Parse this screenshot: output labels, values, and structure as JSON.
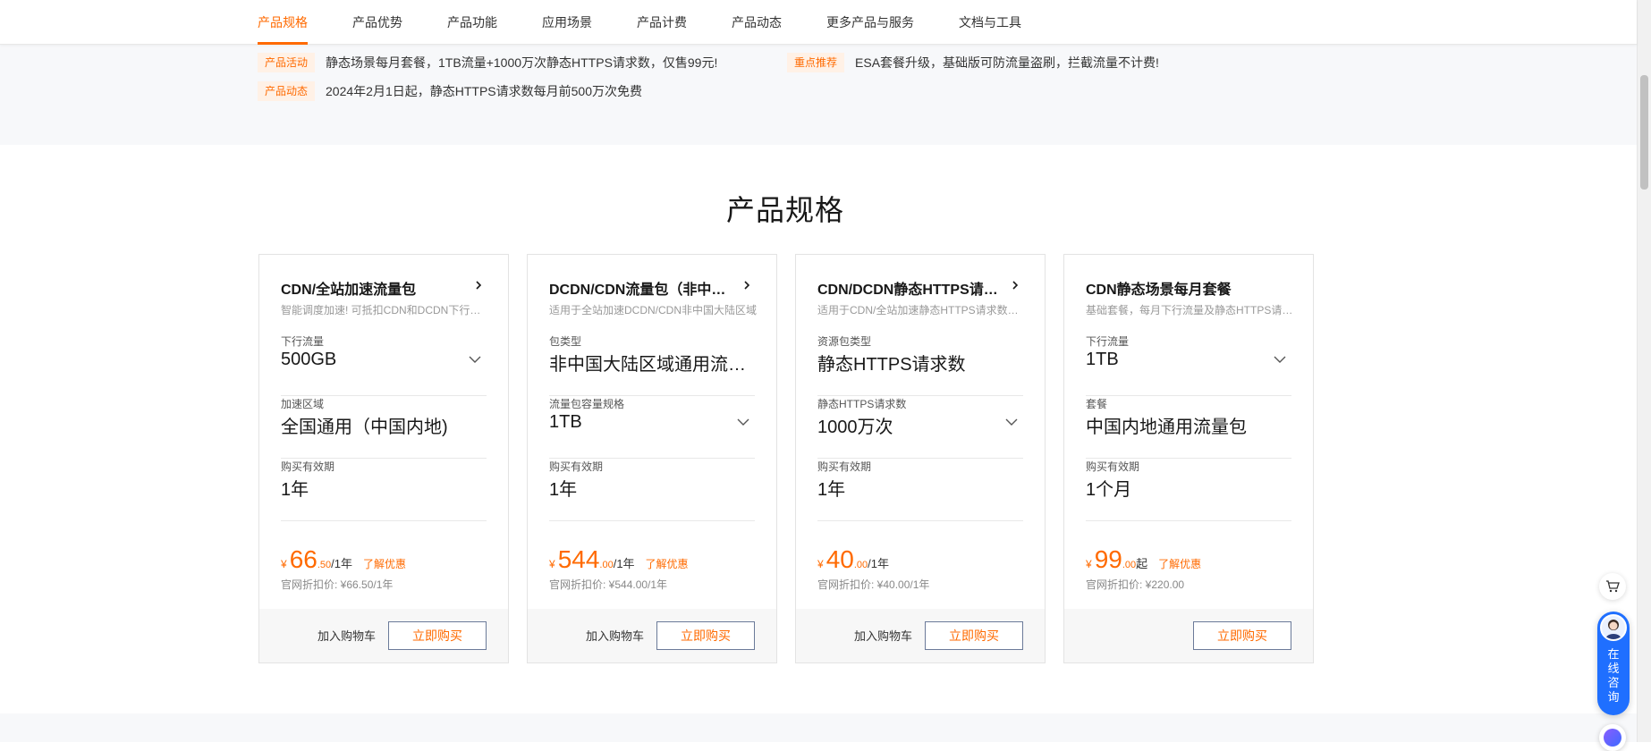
{
  "nav": {
    "tabs": [
      {
        "label": "产品规格",
        "active": true
      },
      {
        "label": "产品优势"
      },
      {
        "label": "产品功能"
      },
      {
        "label": "应用场景"
      },
      {
        "label": "产品计费"
      },
      {
        "label": "产品动态"
      },
      {
        "label": "更多产品与服务"
      },
      {
        "label": "文档与工具"
      }
    ]
  },
  "announcements": [
    {
      "tag": "产品活动",
      "text": "静态场景每月套餐，1TB流量+1000万次静态HTTPS请求数，仅售99元!"
    },
    {
      "tag": "重点推荐",
      "text": "ESA套餐升级，基础版可防流量盗刷，拦截流量不计费!"
    },
    {
      "tag": "产品动态",
      "text": "2024年2月1日起，静态HTTPS请求数每月前500万次免费"
    }
  ],
  "section_title": "产品规格",
  "cards": [
    {
      "title": "CDN/全站加速流量包",
      "desc": "智能调度加速! 可抵扣CDN和DCDN下行流量",
      "options": [
        {
          "label": "下行流量",
          "value": "500GB",
          "dropdown": true
        },
        {
          "label": "加速区域",
          "value": "全国通用（中国内地)",
          "dropdown": false
        },
        {
          "label": "购买有效期",
          "value": "1年",
          "dropdown": false
        }
      ],
      "currency": "¥",
      "price_int": "66",
      "price_dec": ".50",
      "price_unit": "/1年",
      "promo": "了解优惠",
      "orig_price": "官网折扣价: ¥66.50/1年",
      "cart_label": "加入购物车",
      "buy_label": "立即购买"
    },
    {
      "title": "DCDN/CDN流量包（非中国大陆）",
      "desc": "适用于全站加速DCDN/CDN非中国大陆区域",
      "options": [
        {
          "label": "包类型",
          "value": "非中国大陆区域通用流量包",
          "dropdown": false
        },
        {
          "label": "流量包容量规格",
          "value": "1TB",
          "dropdown": true
        },
        {
          "label": "购买有效期",
          "value": "1年",
          "dropdown": false
        }
      ],
      "currency": "¥",
      "price_int": "544",
      "price_dec": ".00",
      "price_unit": "/1年",
      "promo": "了解优惠",
      "orig_price": "官网折扣价: ¥544.00/1年",
      "cart_label": "加入购物车",
      "buy_label": "立即购买"
    },
    {
      "title": "CDN/DCDN静态HTTPS请求数包",
      "desc": "适用于CDN/全站加速静态HTTPS请求数抵扣",
      "options": [
        {
          "label": "资源包类型",
          "value": "静态HTTPS请求数",
          "dropdown": false
        },
        {
          "label": "静态HTTPS请求数",
          "value": "1000万次",
          "dropdown": true
        },
        {
          "label": "购买有效期",
          "value": "1年",
          "dropdown": false
        }
      ],
      "currency": "¥",
      "price_int": "40",
      "price_dec": ".00",
      "price_unit": "/1年",
      "promo": "",
      "orig_price": "官网折扣价: ¥40.00/1年",
      "cart_label": "加入购物车",
      "buy_label": "立即购买"
    },
    {
      "title": "CDN静态场景每月套餐",
      "desc": "基础套餐，每月下行流量及静态HTTPS请求数",
      "options": [
        {
          "label": "下行流量",
          "value": "1TB",
          "dropdown": true
        },
        {
          "label": "套餐",
          "value": "中国内地通用流量包",
          "dropdown": false
        },
        {
          "label": "购买有效期",
          "value": "1个月",
          "dropdown": false
        }
      ],
      "currency": "¥",
      "price_int": "99",
      "price_dec": ".00",
      "price_unit": "起",
      "promo": "了解优惠",
      "orig_price": "官网折扣价: ¥220.00",
      "cart_label": "",
      "buy_label": "立即购买"
    }
  ],
  "consult": {
    "chars": [
      "在",
      "线",
      "咨",
      "询"
    ]
  },
  "colors": {
    "accent": "#ff6a00",
    "consult_blue": "#1f6fff"
  }
}
